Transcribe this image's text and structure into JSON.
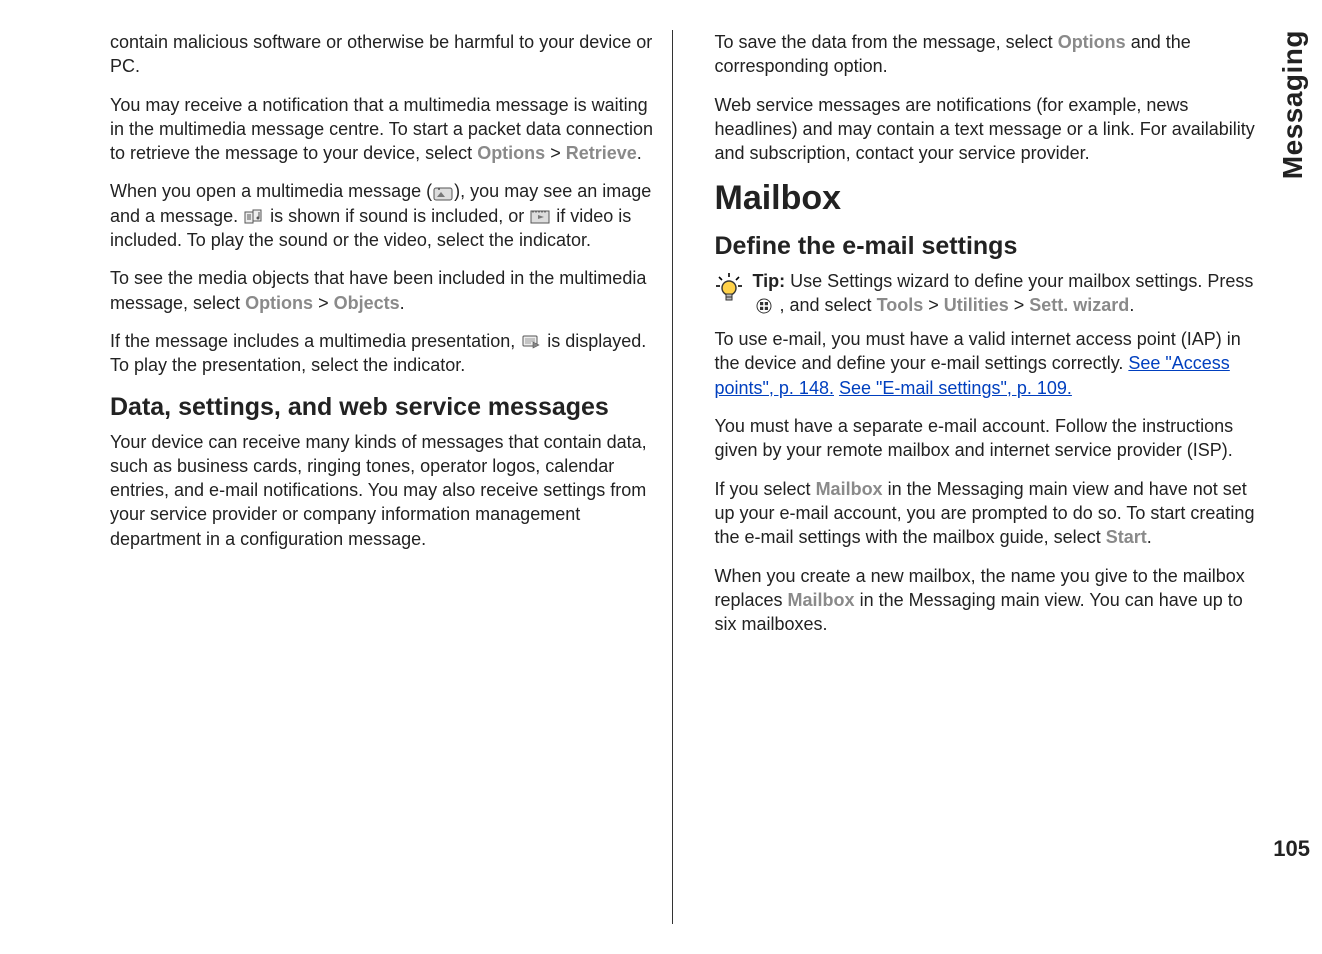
{
  "sidebar": {
    "section": "Messaging",
    "pageNumber": "105"
  },
  "left": {
    "p1": "contain malicious software or otherwise be harmful to your device or PC.",
    "p2a": "You may receive a notification that a multimedia message is waiting in the multimedia message centre. To start a packet data connection to retrieve the message to your device, select ",
    "p2_options": "Options",
    "p2_gt": " > ",
    "p2_retrieve": "Retrieve",
    "p2_end": ".",
    "p3a": "When you open a multimedia message (",
    "p3b": "), you may see an image and a message. ",
    "p3c": " is shown if sound is included, or ",
    "p3d": " if video is included. To play the sound or the video, select the indicator.",
    "p4a": "To see the media objects that have been included in the multimedia message, select ",
    "p4_options": "Options",
    "p4_gt": " > ",
    "p4_objects": "Objects",
    "p4_end": ".",
    "p5a": "If the message includes a multimedia presentation, ",
    "p5b": " is displayed. To play the presentation, select the indicator.",
    "h3": "Data, settings, and web service messages",
    "p6": "Your device can receive many kinds of messages that contain data, such as business cards, ringing tones, operator logos, calendar entries, and e-mail notifications. You may also receive settings from your service provider or company information management department in a configuration message."
  },
  "right": {
    "p1a": "To save the data from the message, select ",
    "p1_options": "Options",
    "p1b": " and the corresponding option.",
    "p2": "Web service messages are notifications (for example, news headlines) and may contain a text message or a link. For availability and subscription, contact your service provider.",
    "h2": "Mailbox",
    "h3": "Define the e-mail settings",
    "tip_label": "Tip: ",
    "tip_a": "Use Settings wizard to define your mailbox settings. Press ",
    "tip_b": " , and select ",
    "tip_tools": "Tools",
    "tip_gt1": " > ",
    "tip_utilities": "Utilities",
    "tip_gt2": " > ",
    "tip_wizard": "Sett. wizard",
    "tip_end": ".",
    "p3a": "To use e-mail, you must have a valid internet access point (IAP) in the device and define your e-mail settings correctly. ",
    "p3_link1": "See \"Access points\", p. 148.",
    "p3_space": " ",
    "p3_link2": "See \"E-mail settings\", p. 109.",
    "p4": "You must have a separate e-mail account. Follow the instructions given by your remote mailbox and internet service provider (ISP).",
    "p5a": "If you select ",
    "p5_mailbox": "Mailbox",
    "p5b": " in the Messaging main view and have not set up your e-mail account, you are prompted to do so. To start creating the e-mail settings with the mailbox guide, select ",
    "p5_start": "Start",
    "p5c": ".",
    "p6a": "When you create a new mailbox, the name you give to the mailbox replaces ",
    "p6_mailbox": "Mailbox",
    "p6b": " in the Messaging main view. You can have up to six mailboxes."
  }
}
